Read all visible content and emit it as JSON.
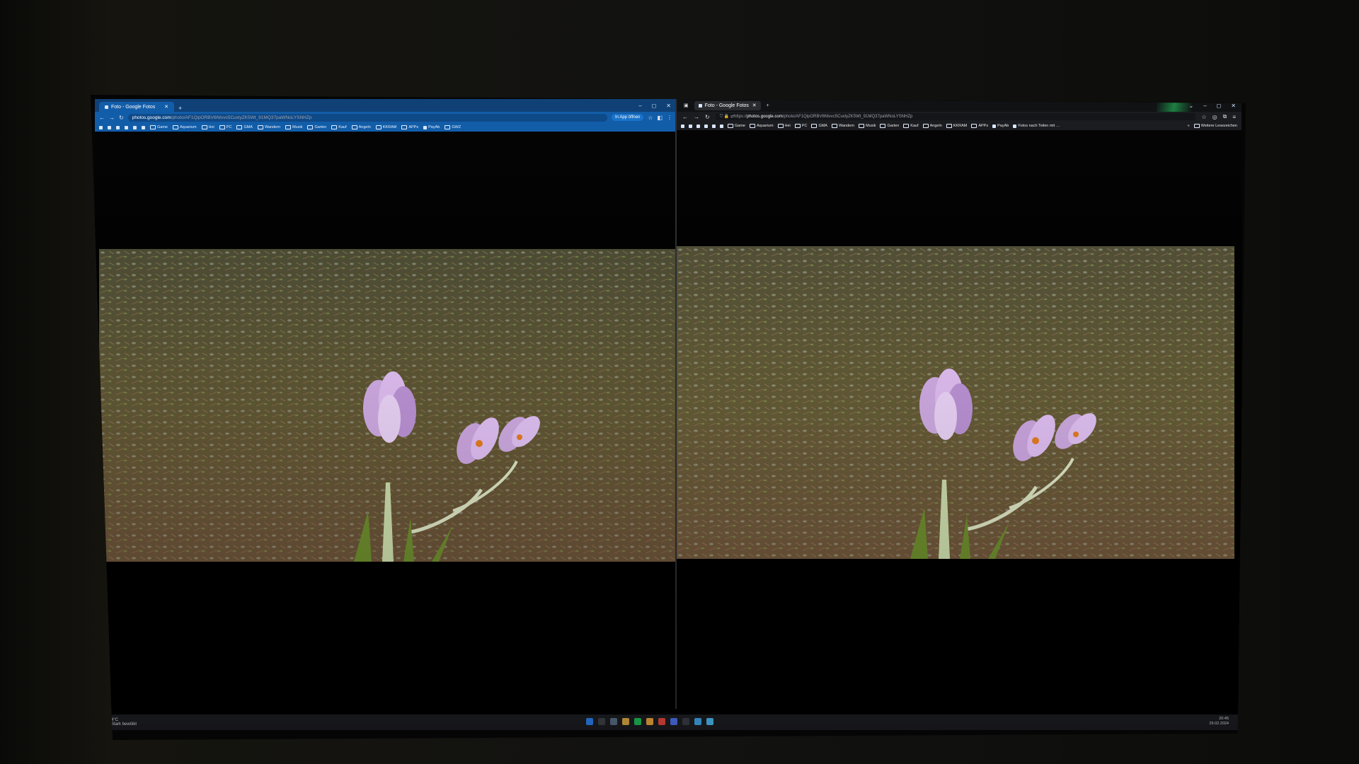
{
  "left_browser": {
    "tab_title": "Foto - Google Fotos",
    "new_tab": "+",
    "url_host": "photos.google.com",
    "url_path": "/photo/AF1QipORBV6NIvvc5CuxlyZK5Wt_91MQ37paWNoLYSNHZp",
    "app_button": "In App öffnen",
    "window_controls": [
      "–",
      "◻",
      "✕"
    ],
    "bookmarks": [
      "Game",
      "Aquarium",
      "Hei",
      "PC",
      "GMA",
      "Wandern",
      "Musik",
      "Garten",
      "Kauf",
      "Angeln",
      "KKRAM",
      "APPs",
      "PayAb",
      "GWZ"
    ]
  },
  "right_browser": {
    "tab_title": "Foto - Google Fotos",
    "new_tab": "+",
    "url_scheme": "https://",
    "url_host": "photos.google.com",
    "url_path": "/photo/AF1QipORBV6NIvvc5CuxlyZK5Wt_91MQ37paWNoLYSNHZp",
    "window_controls": [
      "⌄",
      "–",
      "◻",
      "✕"
    ],
    "bookmarks": [
      "Game",
      "Aquarium",
      "Hei",
      "PC",
      "GMA",
      "Wandern",
      "Musik",
      "Garten",
      "Kauf",
      "Angeln",
      "KKRAM",
      "APPs",
      "PayAb",
      "Fotos nach Teilen mit …"
    ],
    "other_bookmarks": "Weitere Lesezeichen"
  },
  "taskbar": {
    "weather_temp": "4°C",
    "weather_desc": "Stark bewölkt",
    "time": "20:45",
    "date": "29.02.2024",
    "icon_colors": [
      "#2b7de9",
      "#3d3f45",
      "#5a6b84",
      "#d9a640",
      "#1db954",
      "#e9a23b",
      "#e0453b",
      "#4b6ee8",
      "#3a3c44",
      "#3fa3e8",
      "#49b6f0"
    ]
  },
  "colors": {
    "chrome_frame": "#0e5aa7",
    "firefox_frame": "#17181c",
    "taskbar": "#1b1c20"
  }
}
